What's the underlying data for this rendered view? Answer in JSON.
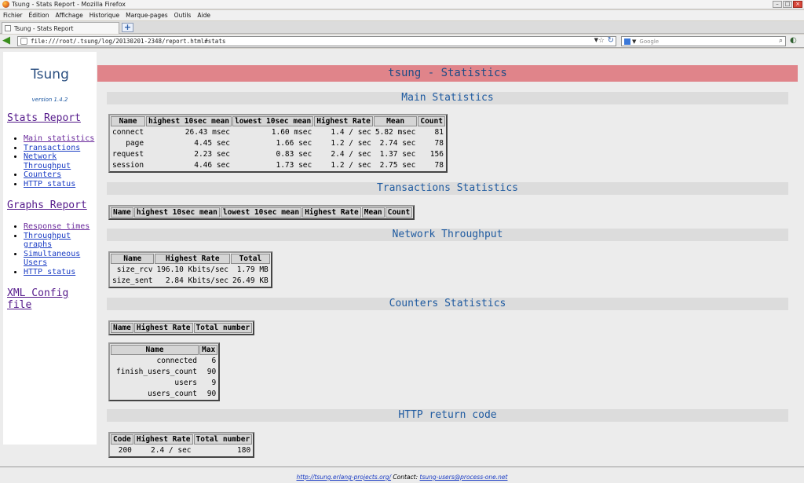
{
  "window": {
    "title": "Tsung - Stats Report - Mozilla Firefox",
    "menu": [
      "Fichier",
      "Édition",
      "Affichage",
      "Historique",
      "Marque-pages",
      "Outils",
      "Aide"
    ]
  },
  "browser": {
    "tab_title": "Tsung - Stats Report",
    "url": "file:///root/.tsung/log/20130201-2348/report.html#stats",
    "search_placeholder": "Google"
  },
  "sidebar": {
    "logo": "Tsung",
    "version": "version 1.4.2",
    "stats_heading": "Stats Report",
    "stats_links": [
      {
        "label": "Main statistics"
      },
      {
        "label": "Transactions"
      },
      {
        "label": "Network"
      },
      {
        "label": "Throughput"
      },
      {
        "label": "Counters"
      },
      {
        "label": "HTTP status"
      }
    ],
    "graphs_heading": "Graphs Report",
    "graphs_links": [
      {
        "label": "Response times"
      },
      {
        "label": "Throughput"
      },
      {
        "label": "graphs"
      },
      {
        "label": "Simultaneous"
      },
      {
        "label": "Users"
      },
      {
        "label": "HTTP status"
      }
    ],
    "xml_heading_line1": "XML Config",
    "xml_heading_line2": "file"
  },
  "main": {
    "title": "tsung - Statistics",
    "main_stats": {
      "heading": "Main Statistics",
      "headers": [
        "Name",
        "highest 10sec mean",
        "lowest 10sec mean",
        "Highest Rate",
        "Mean",
        "Count"
      ],
      "rows": [
        [
          "connect",
          "26.43 msec",
          "1.60 msec",
          "1.4 / sec",
          "5.82 msec",
          "81"
        ],
        [
          "page",
          "4.45 sec",
          "1.66 sec",
          "1.2 / sec",
          "2.74 sec",
          "78"
        ],
        [
          "request",
          "2.23 sec",
          "0.83 sec",
          "2.4 / sec",
          "1.37 sec",
          "156"
        ],
        [
          "session",
          "4.46 sec",
          "1.73 sec",
          "1.2 / sec",
          "2.75 sec",
          "78"
        ]
      ]
    },
    "transactions": {
      "heading": "Transactions Statistics",
      "headers": [
        "Name",
        "highest 10sec mean",
        "lowest 10sec mean",
        "Highest Rate",
        "Mean",
        "Count"
      ]
    },
    "network": {
      "heading": "Network Throughput",
      "headers": [
        "Name",
        "Highest Rate",
        "Total"
      ],
      "rows": [
        [
          "size_rcv",
          "196.10 Kbits/sec",
          "1.79 MB"
        ],
        [
          "size_sent",
          "2.84 Kbits/sec",
          "26.49 KB"
        ]
      ]
    },
    "counters": {
      "heading": "Counters Statistics",
      "headers": [
        "Name",
        "Highest Rate",
        "Total number"
      ],
      "max_headers": [
        "Name",
        "Max"
      ],
      "max_rows": [
        [
          "connected",
          "6"
        ],
        [
          "finish_users_count",
          "90"
        ],
        [
          "users",
          "9"
        ],
        [
          "users_count",
          "90"
        ]
      ]
    },
    "http": {
      "heading": "HTTP return code",
      "headers": [
        "Code",
        "Highest Rate",
        "Total number"
      ],
      "rows": [
        [
          "200",
          "2.4 / sec",
          "180"
        ]
      ]
    }
  },
  "footer": {
    "link1": "http://tsung.erlang-projects.org/",
    "contact_label": " Contact: ",
    "link2": "tsung-users@process-one.net"
  }
}
